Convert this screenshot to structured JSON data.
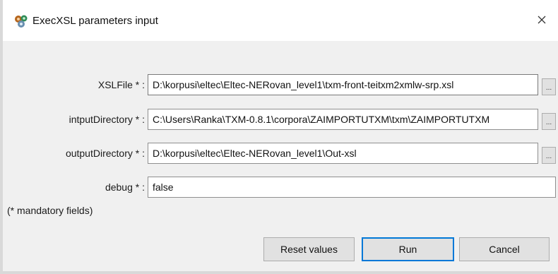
{
  "window": {
    "title": "ExecXSL parameters input",
    "close_label": "×"
  },
  "fields": [
    {
      "label": "XSLFile * :",
      "value": "D:\\korpusi\\eltec\\Eltec-NERovan_level1\\txm-front-teitxm2xmlw-srp.xsl",
      "browse_label": "..."
    },
    {
      "label": "intputDirectory * :",
      "value": "C:\\Users\\Ranka\\TXM-0.8.1\\corpora\\ZAIMPORTUTXM\\txm\\ZAIMPORTUTXM",
      "browse_label": "..."
    },
    {
      "label": "outputDirectory * :",
      "value": "D:\\korpusi\\eltec\\Eltec-NERovan_level1\\Out-xsl",
      "browse_label": "..."
    },
    {
      "label": "debug * :",
      "value": "false"
    }
  ],
  "mandatory_note": "(* mandatory fields)",
  "buttons": {
    "reset": "Reset values",
    "run": "Run",
    "cancel": "Cancel"
  },
  "colors": {
    "accent": "#0078d7",
    "dialog_bg": "#f0f0f0"
  }
}
